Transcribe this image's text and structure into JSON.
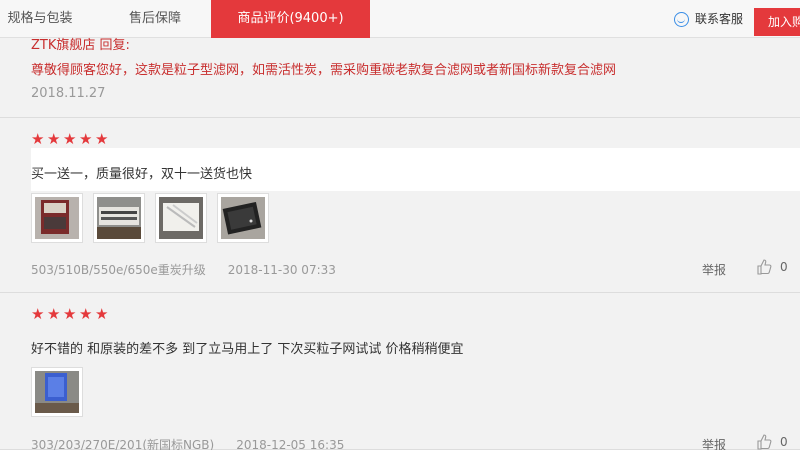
{
  "tabs": {
    "spec": "规格与包装",
    "aftersale": "售后保障",
    "reviews": "商品评价(9400+)"
  },
  "service": {
    "label": "联系客服",
    "icon": "customer-service-icon"
  },
  "join_button": "加入购物车",
  "reply": {
    "head": "ZTK旗舰店 回复:",
    "text": "尊敬得顾客您好，这款是粒子型滤网，如需活性炭，需采购重碳老款复合滤网或者新国标新款复合滤网",
    "date": "2018.11.27"
  },
  "reviews": [
    {
      "stars": 5,
      "content": "买一送一，质量很好，双十一送货也快",
      "images": [
        "product-box-photo",
        "filter-photo-1",
        "filter-photo-2",
        "filter-photo-3"
      ],
      "spec": "503/510B/550e/650e重炭升级",
      "date": "2018-11-30 07:33",
      "report": "举报",
      "likes": "0"
    },
    {
      "stars": 5,
      "content": "好不错的 和原装的差不多 到了立马用上了 下次买粒子网试试 价格稍稍便宜",
      "images": [
        "blue-filter-photo"
      ],
      "spec": "303/203/270E/201(新国标NGB)",
      "date": "2018-12-05 16:35",
      "report": "举报",
      "likes": "0"
    }
  ],
  "colors": {
    "accent": "#e4393c",
    "reply": "#c82e2e",
    "muted": "#999999"
  }
}
